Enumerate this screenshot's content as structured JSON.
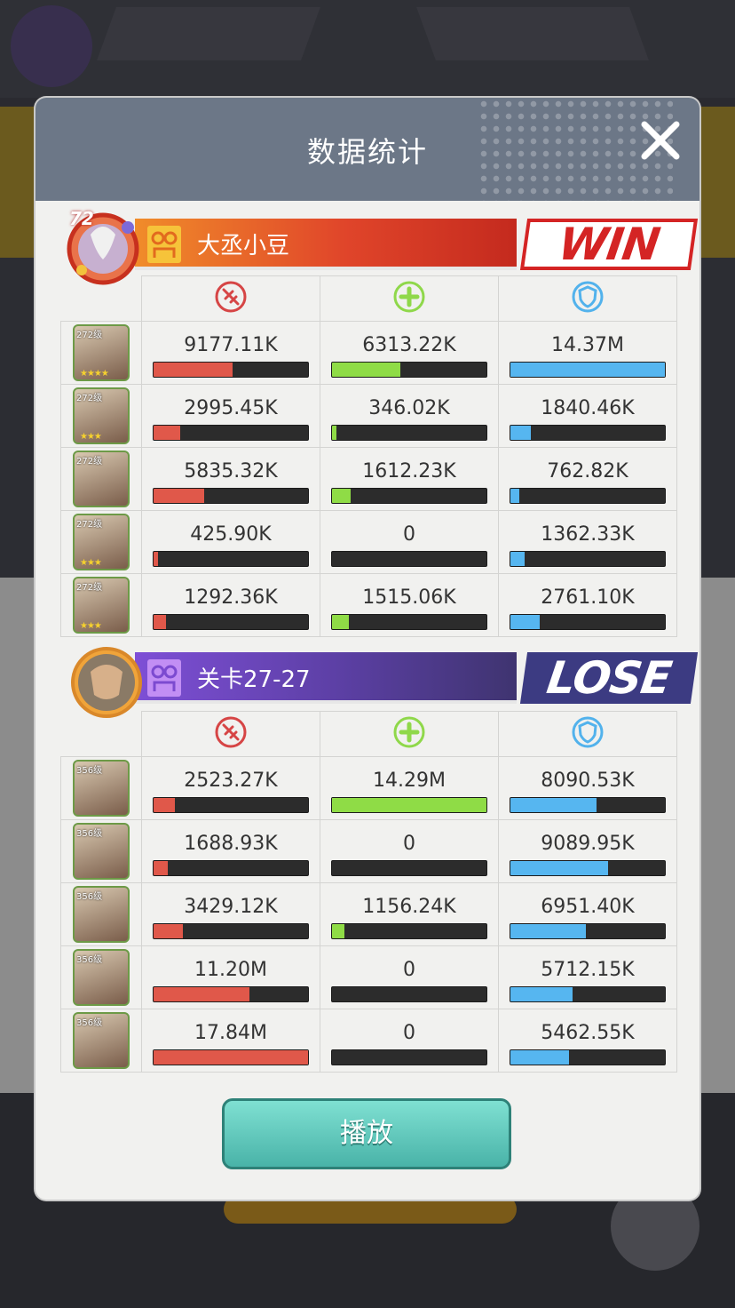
{
  "dialog": {
    "title": "数据统计",
    "play_label": "播放"
  },
  "team1": {
    "level": "72",
    "name": "大丞小豆",
    "result": "WIN",
    "heroes": [
      {
        "level": "272级",
        "stars": "★★★★",
        "dmg": "9177.11K",
        "heal": "6313.22K",
        "tank": "14.37M",
        "dmg_frac": 0.51,
        "heal_frac": 0.44,
        "tank_frac": 1.0
      },
      {
        "level": "272级",
        "stars": "★★★",
        "dmg": "2995.45K",
        "heal": "346.02K",
        "tank": "1840.46K",
        "dmg_frac": 0.17,
        "heal_frac": 0.03,
        "tank_frac": 0.13
      },
      {
        "level": "272级",
        "stars": "",
        "dmg": "5835.32K",
        "heal": "1612.23K",
        "tank": "762.82K",
        "dmg_frac": 0.33,
        "heal_frac": 0.12,
        "tank_frac": 0.06
      },
      {
        "level": "272级",
        "stars": "★★★",
        "dmg": "425.90K",
        "heal": "0",
        "tank": "1362.33K",
        "dmg_frac": 0.03,
        "heal_frac": 0.0,
        "tank_frac": 0.09
      },
      {
        "level": "272级",
        "stars": "★★★",
        "dmg": "1292.36K",
        "heal": "1515.06K",
        "tank": "2761.10K",
        "dmg_frac": 0.08,
        "heal_frac": 0.11,
        "tank_frac": 0.19
      }
    ]
  },
  "team2": {
    "name": "关卡27-27",
    "result": "LOSE",
    "heroes": [
      {
        "level": "356级",
        "stars": "",
        "dmg": "2523.27K",
        "heal": "14.29M",
        "tank": "8090.53K",
        "dmg_frac": 0.14,
        "heal_frac": 1.0,
        "tank_frac": 0.56
      },
      {
        "level": "356级",
        "stars": "",
        "dmg": "1688.93K",
        "heal": "0",
        "tank": "9089.95K",
        "dmg_frac": 0.09,
        "heal_frac": 0.0,
        "tank_frac": 0.63
      },
      {
        "level": "356级",
        "stars": "",
        "dmg": "3429.12K",
        "heal": "1156.24K",
        "tank": "6951.40K",
        "dmg_frac": 0.19,
        "heal_frac": 0.08,
        "tank_frac": 0.49
      },
      {
        "level": "356级",
        "stars": "",
        "dmg": "11.20M",
        "heal": "0",
        "tank": "5712.15K",
        "dmg_frac": 0.62,
        "heal_frac": 0.0,
        "tank_frac": 0.4
      },
      {
        "level": "356级",
        "stars": "",
        "dmg": "17.84M",
        "heal": "0",
        "tank": "5462.55K",
        "dmg_frac": 1.0,
        "heal_frac": 0.0,
        "tank_frac": 0.38
      }
    ]
  },
  "icons": {
    "damage": "damage-icon",
    "heal": "heal-icon",
    "shield": "shield-icon",
    "close": "close-icon"
  },
  "colors": {
    "damage": "#e0584a",
    "heal": "#8fdc46",
    "shield": "#56b6f0",
    "win": "#d42424",
    "lose": "#3c3b82"
  }
}
